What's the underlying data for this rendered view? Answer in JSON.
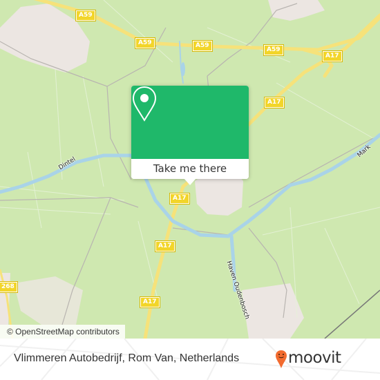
{
  "map": {
    "road_shields": [
      {
        "id": "a59-1",
        "label": "A59"
      },
      {
        "id": "a59-2",
        "label": "A59"
      },
      {
        "id": "a59-3",
        "label": "A59"
      },
      {
        "id": "a59-4",
        "label": "A59"
      },
      {
        "id": "a17-1",
        "label": "A17"
      },
      {
        "id": "a17-2",
        "label": "A17"
      },
      {
        "id": "a17-3",
        "label": "A17"
      },
      {
        "id": "a17-4",
        "label": "A17"
      },
      {
        "id": "a17-5",
        "label": "A17"
      },
      {
        "id": "a17-6",
        "label": "A17"
      },
      {
        "id": "n268",
        "label": "268"
      }
    ],
    "water_labels": {
      "dintel": "Dintel",
      "mark": "Mark",
      "haven": "Haven Oudenbosch"
    },
    "colors": {
      "land": "#cfe8b0",
      "water": "#a9d3e8",
      "motorway": "#f6e27a",
      "urban": "#ece6e2",
      "popup_accent": "#1fb86a",
      "brand_orange": "#f26b2f"
    }
  },
  "popup": {
    "icon": "map-pin-icon",
    "button_label": "Take me there"
  },
  "attribution": "© OpenStreetMap contributors",
  "footer": {
    "place_name": "Vlimmeren Autobedrijf, Rom Van, Netherlands",
    "brand": "moovit",
    "brand_icon": "moovit-pin-icon"
  }
}
